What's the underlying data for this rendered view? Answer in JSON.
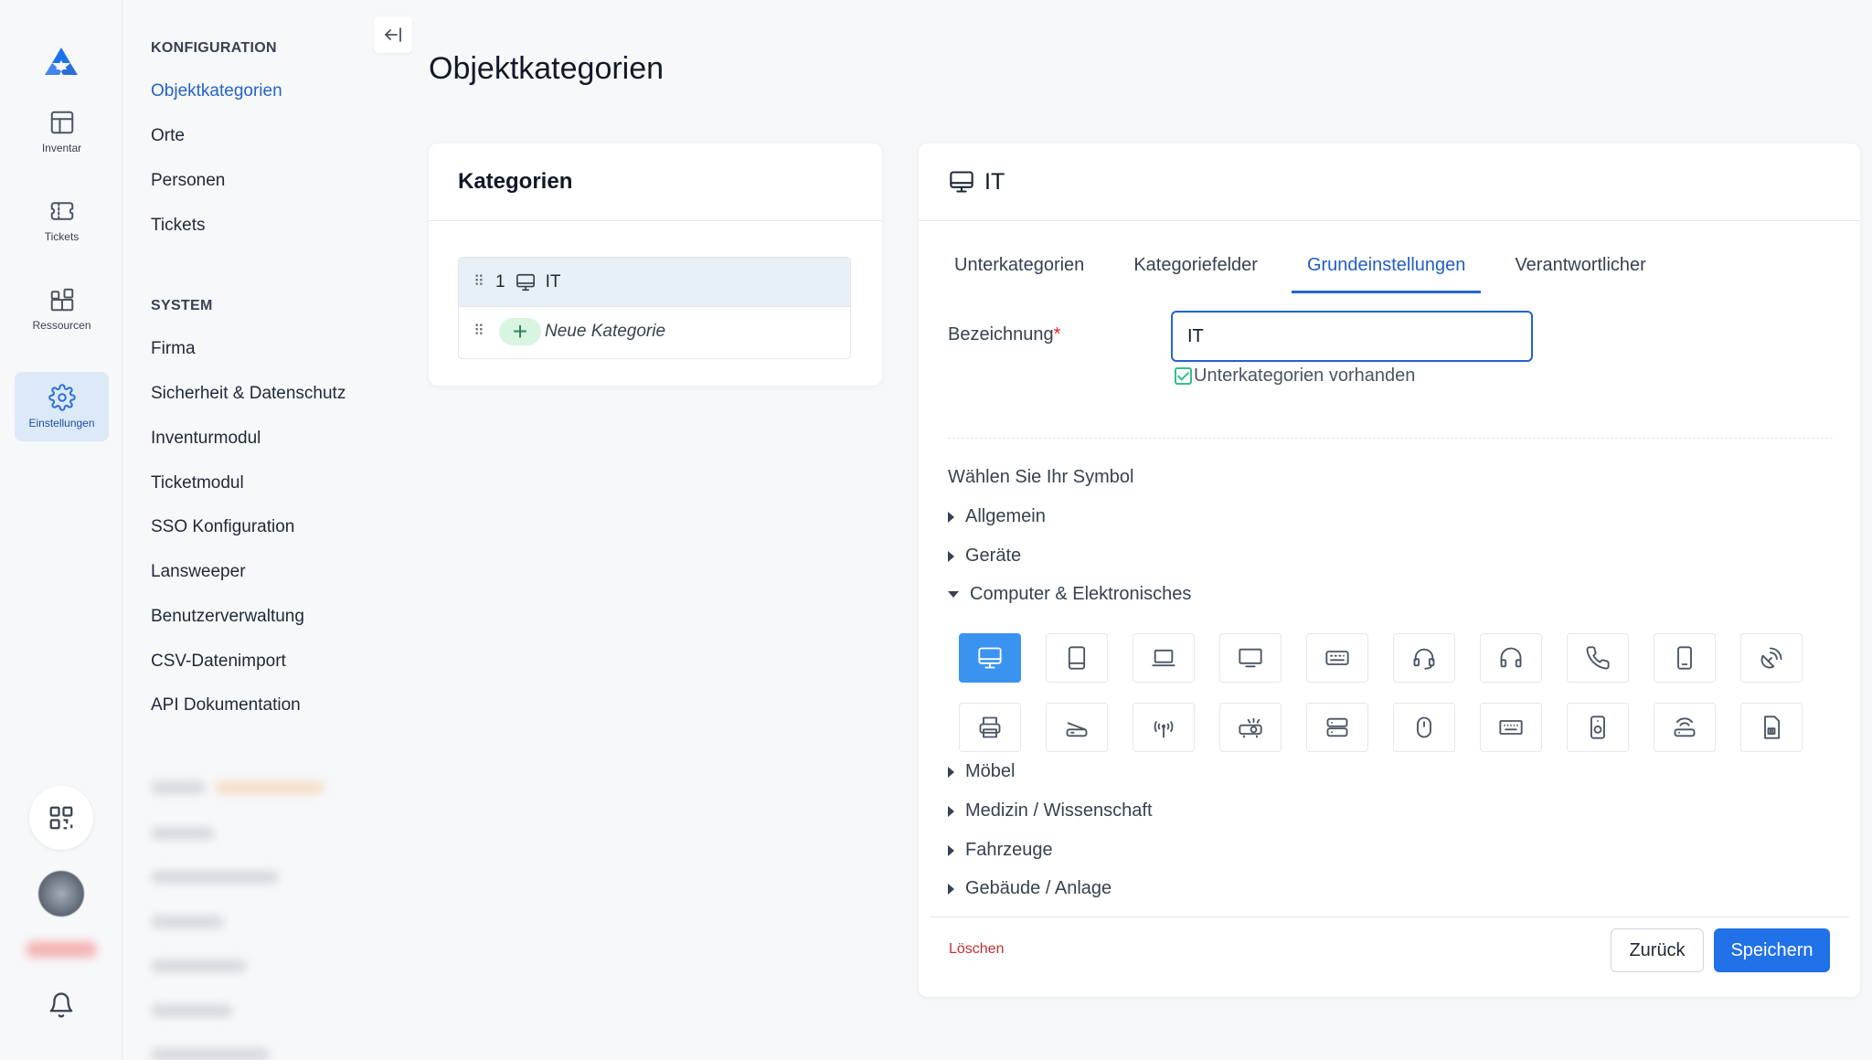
{
  "rail": {
    "items": [
      {
        "label": "Inventar",
        "icon": "table-icon"
      },
      {
        "label": "Tickets",
        "icon": "ticket-icon"
      },
      {
        "label": "Ressourcen",
        "icon": "grid-plus-icon"
      },
      {
        "label": "Einstellungen",
        "icon": "gear-icon"
      }
    ],
    "active": "Einstellungen"
  },
  "sidebar": {
    "config_heading": "KONFIGURATION",
    "config_items": [
      "Objektkategorien",
      "Orte",
      "Personen",
      "Tickets"
    ],
    "system_heading": "SYSTEM",
    "system_items": [
      "Firma",
      "Sicherheit & Datenschutz",
      "Inventurmodul",
      "Ticketmodul",
      "SSO Konfiguration",
      "Lansweeper",
      "Benutzerverwaltung",
      "CSV-Datenimport",
      "API Dokumentation"
    ],
    "active": "Objektkategorien"
  },
  "page": {
    "title": "Objektkategorien"
  },
  "categories_card": {
    "title": "Kategorien",
    "rows": [
      {
        "number": "1",
        "name": "IT",
        "icon": "monitor-icon"
      }
    ],
    "new_label": "Neue Kategorie"
  },
  "detail": {
    "title": "IT",
    "tabs": [
      "Unterkategorien",
      "Kategoriefelder",
      "Grundeinstellungen",
      "Verantwortlicher"
    ],
    "active_tab": "Grundeinstellungen",
    "field_label": "Bezeichnung",
    "required_mark": "*",
    "field_value": "IT",
    "checkbox_label": "Unterkategorien vorhanden",
    "symbol_title": "Wählen Sie Ihr Symbol",
    "sections_before": [
      "Allgemein",
      "Geräte"
    ],
    "expanded_section": "Computer & Elektronisches",
    "sections_after": [
      "Möbel",
      "Medizin / Wissenschaft",
      "Fahrzeuge",
      "Gebäude / Anlage"
    ],
    "icons_row1": [
      "desktop-icon",
      "tablet-icon",
      "laptop-icon",
      "monitor-icon",
      "keyboard-icon",
      "headset-icon",
      "headphones-icon",
      "phone-icon",
      "smartphone-icon",
      "satellite-dish-icon"
    ],
    "icons_row2": [
      "printer-icon",
      "scanner-icon",
      "antenna-icon",
      "projector-icon",
      "server-icon",
      "mouse-icon",
      "keyboard-alt-icon",
      "speaker-icon",
      "router-icon",
      "sd-card-icon"
    ],
    "selected_icon": "desktop-icon",
    "delete_label": "Löschen",
    "back_label": "Zurück",
    "save_label": "Speichern"
  },
  "colors": {
    "accent": "#2563c9",
    "save": "#2171e8",
    "selected_icon_bg": "#3b93f0",
    "delete": "#c53030"
  }
}
